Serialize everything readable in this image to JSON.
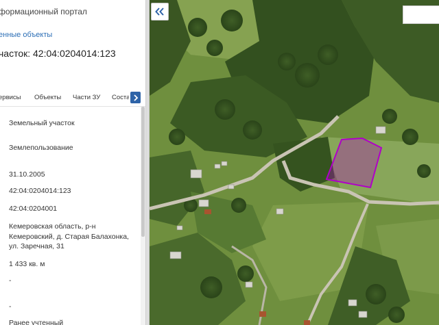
{
  "header": {
    "portal_title": "формационный портал",
    "saved_objects_link": "енные объекты",
    "parcel_title": "часток: 42:04:0204014:123"
  },
  "tabs": [
    {
      "label": "ервисы"
    },
    {
      "label": "Объекты"
    },
    {
      "label": "Части ЗУ"
    },
    {
      "label": "Состав"
    }
  ],
  "details": {
    "object_type": "Земельный участок",
    "category": "Землепользование",
    "date": "31.10.2005",
    "cadastral_number": "42:04:0204014:123",
    "quarter_number": "42:04:0204001",
    "address_line1": "Кемеровская область, р-н",
    "address_line2": "Кемеровский, д. Старая Балахонка,",
    "address_line3": "ул. Заречная, 31",
    "area": "1 433 кв. м",
    "value_dash_1": "-",
    "value_dash_2": "-",
    "status": "Ранее учтенный"
  },
  "colors": {
    "accent": "#2e63a8",
    "link": "#2a6db5",
    "parcel_outline": "#b000c8"
  },
  "icons": {
    "collapse": "double-chevron-left-icon",
    "tab_scroll": "chevron-right-icon"
  }
}
